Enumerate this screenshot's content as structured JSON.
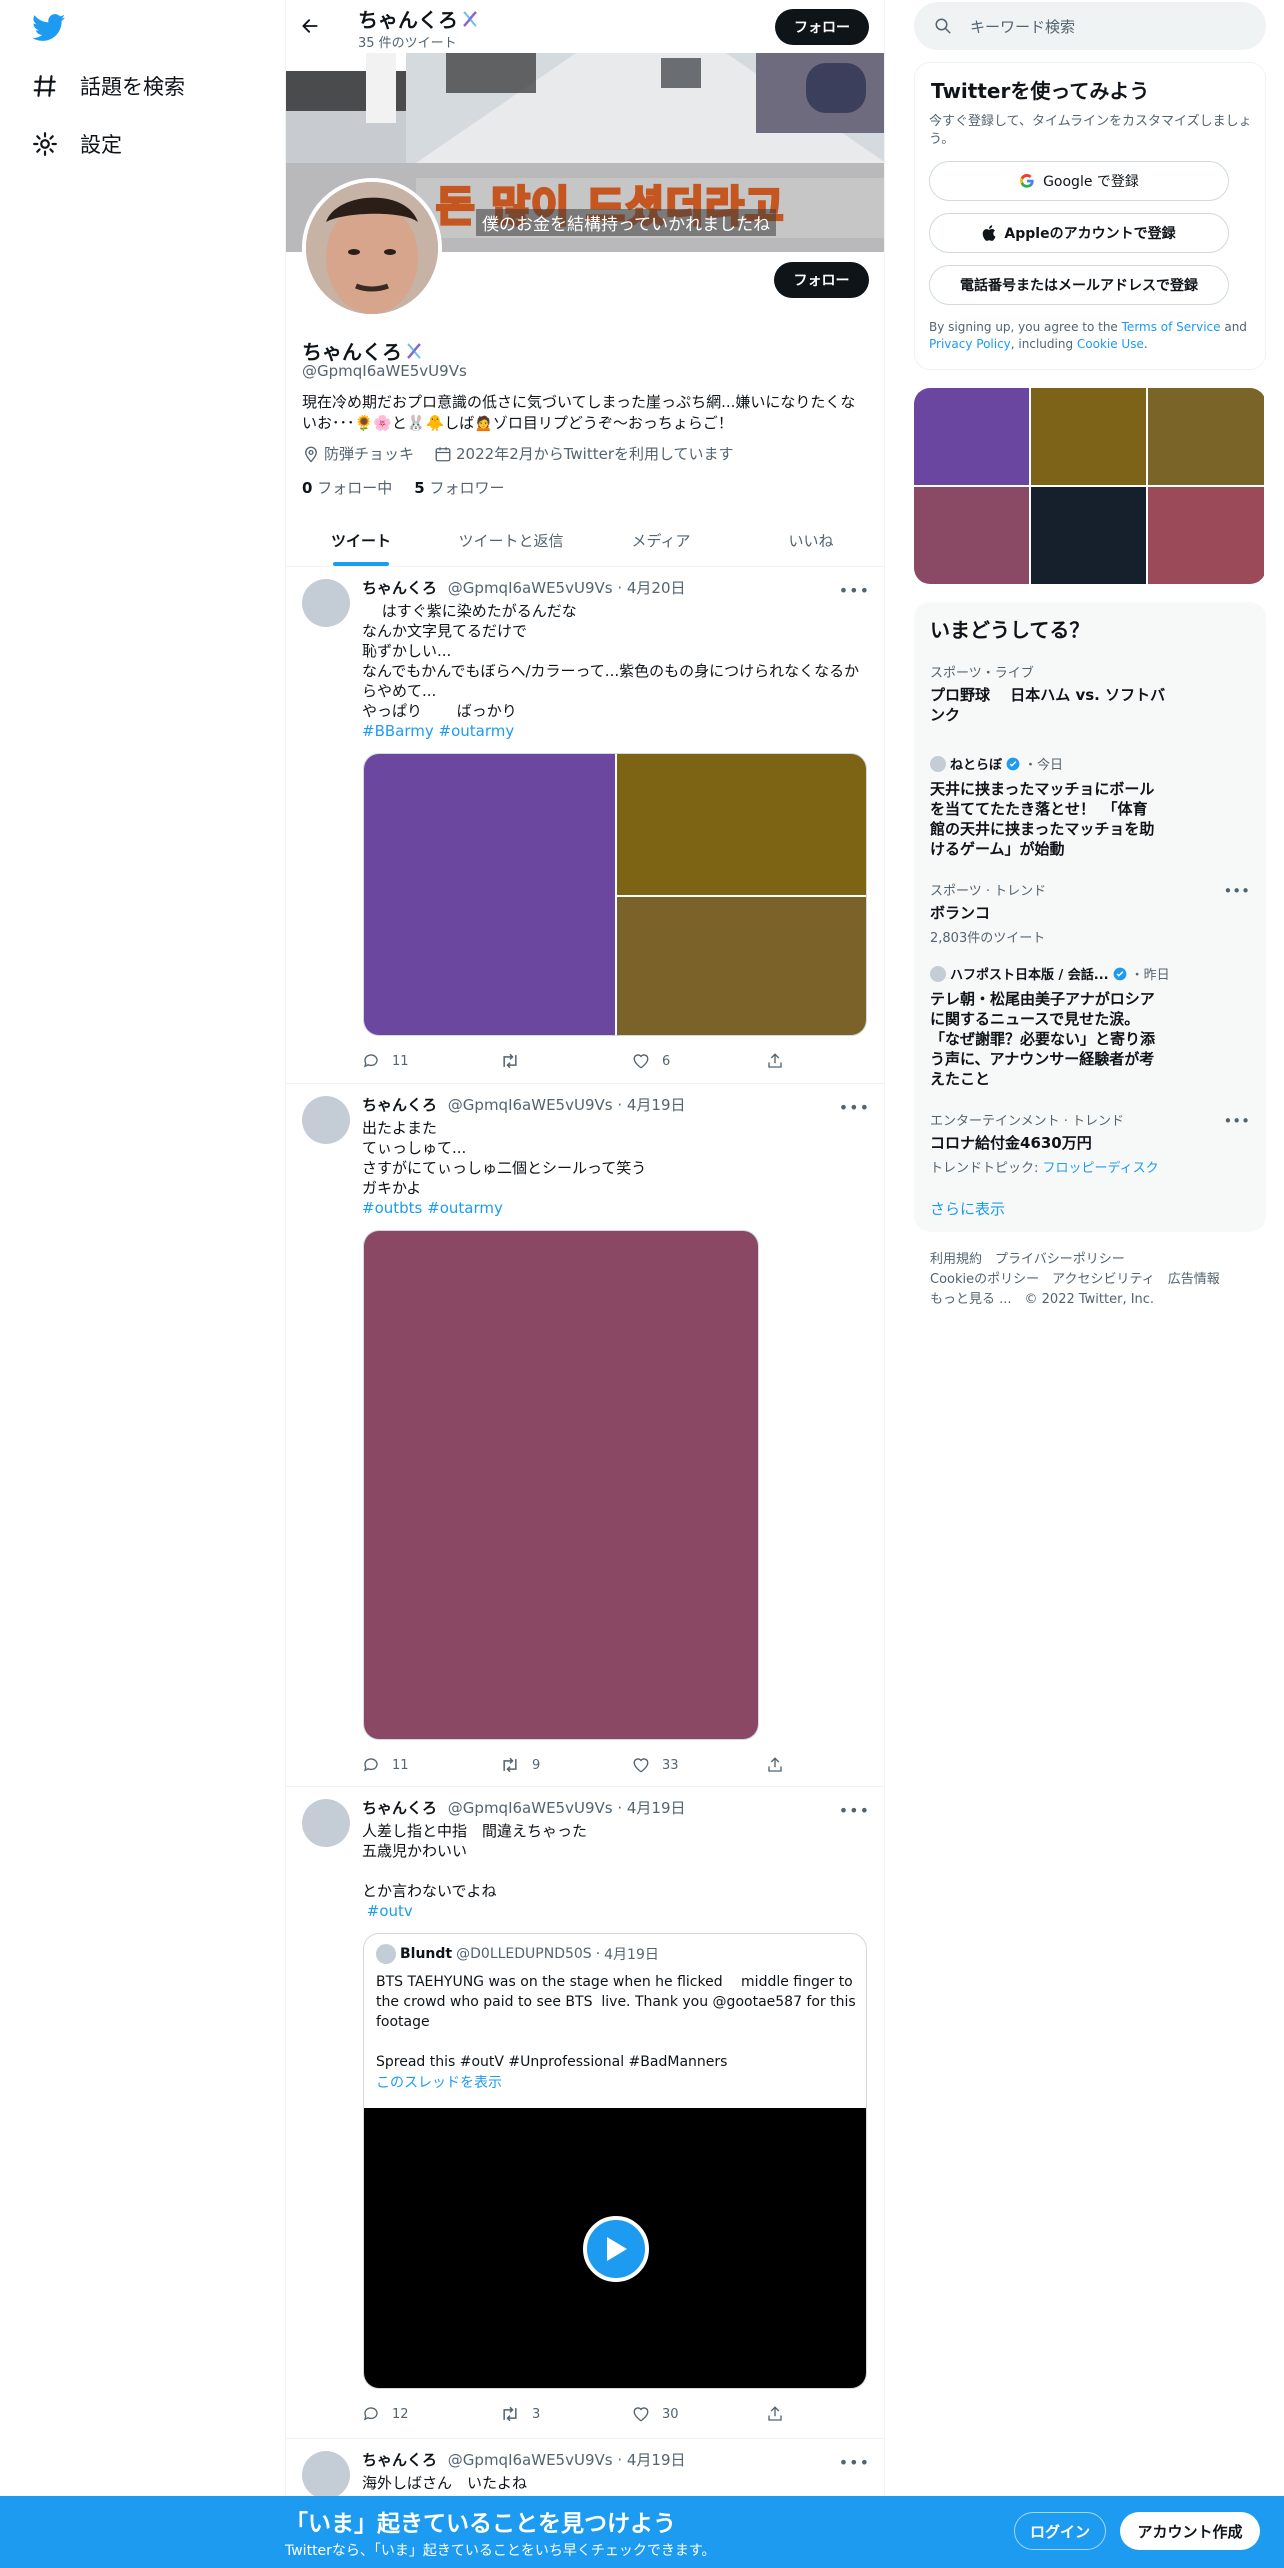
{
  "nav": {
    "explore": "話題を検索",
    "settings": "設定"
  },
  "header": {
    "name": "ちゃんくろ",
    "tweet_count": "35 件のツイート",
    "follow": "フォロー"
  },
  "banner": {
    "korean_text": "돈 많이 드셨더라고",
    "caption": "僕のお金を結構持っていかれましたね"
  },
  "profile": {
    "name": "ちゃんくろ",
    "handle": "@GpmqI6aWE5vU9Vs",
    "bio_line1": "現在冷め期だおプロ意識の低さに気づいてしまった崖っぷち網...嫌いになりたくな",
    "bio_line2": "いお･･･🌻🌸と🐰🐥しば🙍ゾロ目リプどうぞ〜おっちょらご！",
    "location": "防弾チョッキ",
    "joined": "2022年2月からTwitterを利用しています",
    "following_count": "0",
    "following_label": "フォロー中",
    "followers_count": "5",
    "followers_label": "フォロワー",
    "follow": "フォロー"
  },
  "tabs": [
    "ツイート",
    "ツイートと返信",
    "メディア",
    "いいね"
  ],
  "tweets": [
    {
      "name": "ちゃんくろ",
      "handle": "@GpmqI6aWE5vU9Vs",
      "date": "4月20日",
      "text": "　 はすぐ紫に染めたがるんだな\nなんか文字見てるだけで\n恥ずかしい...\nなんでもかんでもぼらへ/カラーって...紫色のもの身につけられなくなるか\nらやめて...\nやっぱり　　 ばっかり",
      "tags": "#BBarmy #outarmy",
      "reply": "11",
      "retweet": "",
      "like": "6",
      "colors": [
        "#6c47a0",
        "#7d6314",
        "#7a6228"
      ]
    },
    {
      "name": "ちゃんくろ",
      "handle": "@GpmqI6aWE5vU9Vs",
      "date": "4月19日",
      "text": "出たよまた\nてぃっしゅて...\nさすがにてぃっしゅ二個とシールって笑う\nガキかよ",
      "tags": "#outbts #outarmy",
      "reply": "11",
      "retweet": "9",
      "like": "33",
      "colors": [
        "#8a4865"
      ]
    },
    {
      "name": "ちゃんくろ",
      "handle": "@GpmqI6aWE5vU9Vs",
      "date": "4月19日",
      "text": "人差し指と中指　間違えちゃった\n五歳児かわいい\n\nとか言わないでよね",
      "tags": " #outv",
      "reply": "12",
      "retweet": "3",
      "like": "30",
      "quote": {
        "name": "Blundt",
        "handle": "@D0LLEDUPND50S",
        "date": "4月19日",
        "text": "BTS TAEHYUNG was on the stage when he flicked 　middle finger to\nthe crowd who paid to see BTS  live. Thank you @gootae587 for this\nfootage\n\nSpread this #outV #Unprofessional #BadManners",
        "thread": "このスレッドを表示"
      }
    },
    {
      "name": "ちゃんくろ",
      "handle": "@GpmqI6aWE5vU9Vs",
      "date": "4月19日",
      "text": "海外しばさん　いたよね"
    }
  ],
  "right": {
    "search_placeholder": "キーワード検索",
    "signup_title": "Twitterを使ってみよう",
    "signup_sub": "今すぐ登録して、タイムラインをカスタマイズしましょう。",
    "google": "Google で登録",
    "apple": "Appleのアカウントで登録",
    "phone": "電話番号またはメールアドレスで登録",
    "terms_pre": "By signing up, you agree to the ",
    "terms_link": "Terms of Service",
    "terms_and": " and",
    "privacy_link": "Privacy Policy",
    "terms_inc": ", including ",
    "cookie_link": "Cookie Use",
    "terms_end": ".",
    "media_colors": [
      "#6b46a1",
      "#7d6317",
      "#7b6428",
      "#8a4a66",
      "#16202c",
      "#9b4a59"
    ],
    "trends_title": "いまどうしてる？",
    "trends": [
      {
        "meta": "スポーツ・ライブ",
        "title": "プロ野球　 日本ハム vs. ソフトバ\nンク"
      },
      {
        "meta_name": "ねとらぼ",
        "meta_time": "・今日",
        "title": "天井に挟まったマッチョにボール\nを当ててたたき落とせ！　「体育\n館の天井に挟まったマッチョを助\nけるゲーム」が始動"
      },
      {
        "meta": "スポーツ · トレンド",
        "title": "ボランコ",
        "count": "2,803件のツイート"
      },
      {
        "meta_name": "ハフポスト日本版 / 会話...",
        "meta_time": "・昨日",
        "title": "テレ朝・松尾由美子アナがロシア\nに関するニュースで見せた涙。\n「なぜ謝罪？必要ない」と寄り添\nう声に、アナウンサー経験者が考\nえたこと"
      },
      {
        "meta": "エンターテインメント · トレンド",
        "title": "コロナ給付金4630万円",
        "topic_pre": "トレンドトピック: ",
        "topic": "フロッピーディスク"
      }
    ],
    "show_more": "さらに表示",
    "footer1": "利用規約　プライバシーポリシー",
    "footer2": "Cookieのポリシー　アクセシビリティ　広告情報",
    "footer3": "もっと見る ...　© 2022 Twitter, Inc."
  },
  "bottom": {
    "title": "「いま」起きていることを見つけよう",
    "sub": "Twitterなら、「いま」起きていることをいち早くチェックできます。",
    "login": "ログイン",
    "signup": "アカウント作成"
  }
}
